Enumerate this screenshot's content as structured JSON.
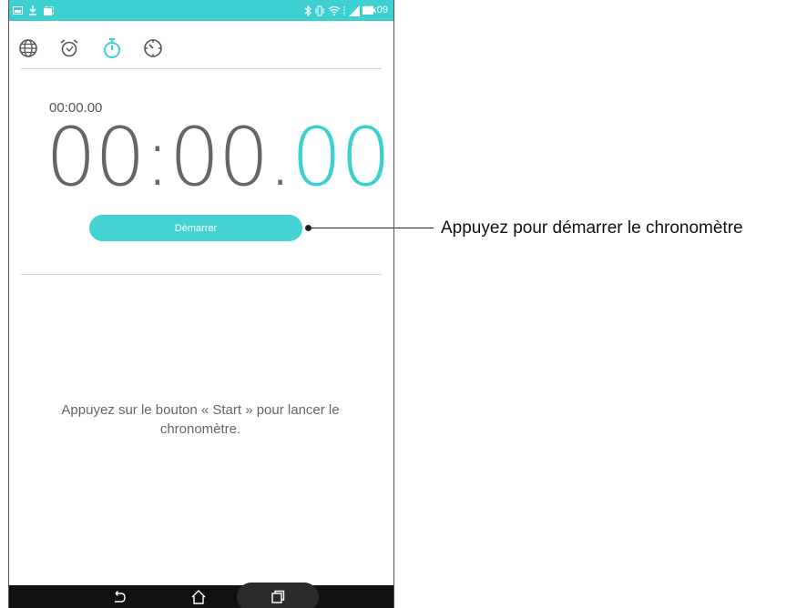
{
  "status_bar": {
    "time": "05:09",
    "left_icons": [
      "gallery-icon",
      "download-icon",
      "photo-icon"
    ],
    "right_icons": [
      "bluetooth-icon",
      "vibrate-icon",
      "wifi-icon",
      "sim-icon",
      "battery-icon"
    ],
    "background": "#3ecfd0"
  },
  "tabs": [
    {
      "name": "world-clock-tab",
      "icon": "globe-icon",
      "active": false
    },
    {
      "name": "alarm-tab",
      "icon": "alarm-clock-icon",
      "active": false
    },
    {
      "name": "stopwatch-tab",
      "icon": "stopwatch-icon",
      "active": true
    },
    {
      "name": "timer-tab",
      "icon": "timer-icon",
      "active": false
    }
  ],
  "stopwatch": {
    "lap_time": "00:00.00",
    "main_time": "00:00.",
    "centiseconds": "00",
    "start_label": "Démarrer",
    "hint": "Appuyez sur le bouton « Start » pour lancer le chronomètre."
  },
  "callout": {
    "text": "Appuyez pour démarrer le chronomètre"
  },
  "nav_bar": {
    "buttons": [
      "back-icon",
      "home-icon",
      "recent-apps-icon"
    ]
  },
  "colors": {
    "accent": "#3ecfd0",
    "button": "#44d3d2",
    "text": "#666666"
  }
}
